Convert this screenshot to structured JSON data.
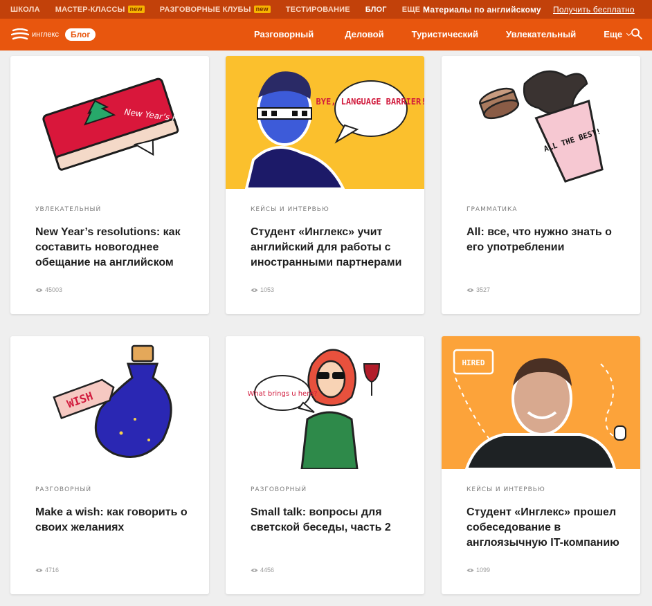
{
  "topbar": {
    "items": [
      {
        "label": "ШКОЛА"
      },
      {
        "label": "МАСТЕР-КЛАССЫ",
        "badge": "new"
      },
      {
        "label": "РАЗГОВОРНЫЕ КЛУБЫ",
        "badge": "new"
      },
      {
        "label": "ТЕСТИРОВАНИЕ"
      },
      {
        "label": "БЛОГ"
      },
      {
        "label": "ЕЩЕ"
      }
    ],
    "promo_text": "Материалы по английскому",
    "promo_link": "Получить бесплатно"
  },
  "header": {
    "logo_text": "инглекс",
    "blog_label": "Блог",
    "nav": [
      "Разговорный",
      "Деловой",
      "Туристический",
      "Увлекательный",
      "Еще"
    ],
    "search_icon": "search-icon"
  },
  "colors": {
    "topbar_bg": "#c2410a",
    "header_bg": "#e8560e",
    "accent_yellow": "#fbc02d",
    "accent_orange": "#fca33a"
  },
  "cards": [
    {
      "category": "УВЛЕКАТЕЛЬНЫЙ",
      "title": "New Year’s resolutions: как составить новогоднее обещание на английском",
      "views": "45003",
      "image_text": "New Year’s Resolutions"
    },
    {
      "category": "КЕЙСЫ И ИНТЕРВЬЮ",
      "title": "Студент «Инглекс» учит английский для работы с иностранными партнерами",
      "views": "1053",
      "image_text": "BYE, LANGUAGE BARRIER!"
    },
    {
      "category": "ГРАММАТИКА",
      "title": "All: все, что нужно знать о его употреблении",
      "views": "3527",
      "image_text": "ALL THE BEST!"
    },
    {
      "category": "РАЗГОВОРНЫЙ",
      "title": "Make a wish: как говорить о своих желаниях",
      "views": "4716",
      "image_text": "WISH"
    },
    {
      "category": "РАЗГОВОРНЫЙ",
      "title": "Small talk: вопросы для светской беседы, часть 2",
      "views": "4456",
      "image_text": "What brings u here?"
    },
    {
      "category": "КЕЙСЫ И ИНТЕРВЬЮ",
      "title": "Студент «Инглекс» прошел собеседование в англоязычную IT-компанию",
      "views": "1099",
      "image_text": "HIRED"
    }
  ]
}
